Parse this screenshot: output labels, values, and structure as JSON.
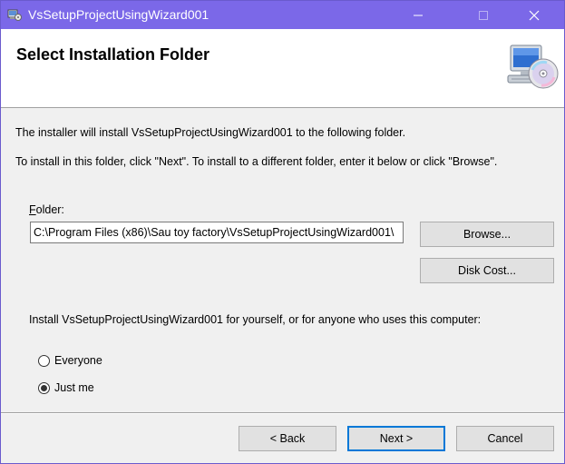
{
  "window": {
    "title": "VsSetupProjectUsingWizard001"
  },
  "header": {
    "page_title": "Select Installation Folder"
  },
  "body": {
    "line1": "The installer will install VsSetupProjectUsingWizard001 to the following folder.",
    "line2": "To install in this folder, click \"Next\". To install to a different folder, enter it below or click \"Browse\".",
    "folder_label_mnemonic": "F",
    "folder_label_rest": "older:",
    "folder_value": "C:\\Program Files (x86)\\Sau toy factory\\VsSetupProjectUsingWizard001\\",
    "browse_label": "Browse...",
    "disk_cost_label": "Disk Cost...",
    "scope_text": "Install VsSetupProjectUsingWizard001 for yourself, or for anyone who uses this computer:",
    "radio_everyone": "Everyone",
    "radio_justme": "Just me",
    "selected_scope": "Just me"
  },
  "footer": {
    "back_label": "< Back",
    "next_label": "Next >",
    "cancel_label": "Cancel"
  },
  "colors": {
    "titlebar": "#7b68e8",
    "default_button_border": "#0078d7"
  },
  "icons": {
    "app": "installer-app-icon",
    "header": "computer-with-cd-icon"
  }
}
